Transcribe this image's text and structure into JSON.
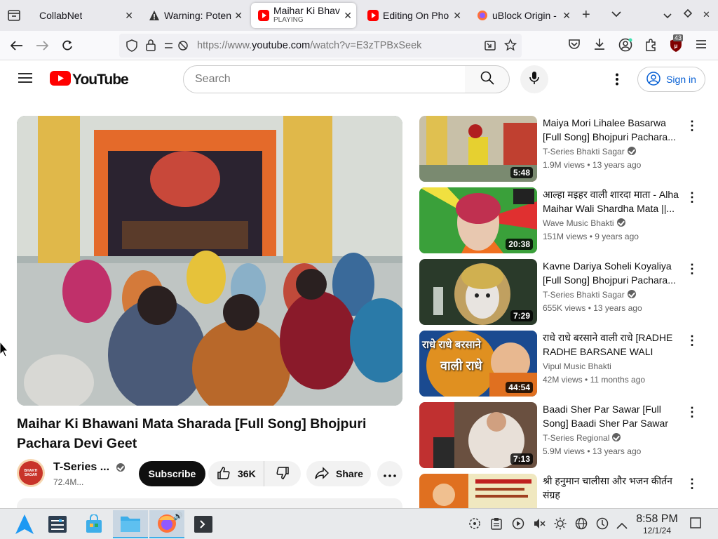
{
  "browser": {
    "tabs": [
      {
        "label": "CollabNet",
        "active": false
      },
      {
        "label": "Warning: Poten",
        "active": false
      },
      {
        "label": "Maihar Ki Bhav",
        "sublabel": "PLAYING",
        "active": true
      },
      {
        "label": "Editing On Pho",
        "active": false
      },
      {
        "label": "uBlock Origin -",
        "active": false
      }
    ],
    "url_prefix": "https://www.",
    "url_host": "youtube.com",
    "url_path": "/watch?v=E3zTPBxSeek",
    "ublock_count": "43"
  },
  "youtube": {
    "logo_text": "YouTube",
    "search_placeholder": "Search",
    "sign_in": "Sign in"
  },
  "video": {
    "title": "Maihar Ki Bhawani Mata Sharada [Full Song] Bhojpuri Pachara Devi Geet",
    "channel": "T-Series ...",
    "subscribers": "72.4M...",
    "subscribe_label": "Subscribe",
    "likes": "36K",
    "share_label": "Share",
    "avatar_text": "BHAKTI SAGAR"
  },
  "recommendations": [
    {
      "title": "Maiya Mori Lihalee Basarwa [Full Song] Bhojpuri Pachara...",
      "channel": "T-Series Bhakti Sagar",
      "verified": true,
      "views": "1.9M views",
      "age": "13 years ago",
      "duration": "5:48"
    },
    {
      "title": "आल्हा मइहर वाली शारदा माता - Alha Maihar Wali Shardha Mata ||...",
      "channel": "Wave Music Bhakti",
      "verified": true,
      "views": "151M views",
      "age": "9 years ago",
      "duration": "20:38"
    },
    {
      "title": "Kavne Dariya Soheli Koyaliya [Full Song] Bhojpuri Pachara...",
      "channel": "T-Series Bhakti Sagar",
      "verified": true,
      "views": "655K views",
      "age": "13 years ago",
      "duration": "7:29"
    },
    {
      "title": "राधे राधे बरसाने वाली राधे [RADHE RADHE BARSANE WALI RADH...",
      "channel": "Vipul Music Bhakti",
      "verified": false,
      "views": "42M views",
      "age": "11 months ago",
      "duration": "44:54",
      "thumb_text1": "राधे राधे बरसाने",
      "thumb_text2": "वाली राधे"
    },
    {
      "title": "Baadi Sher Par Sawar [Full Song] Baadi Sher Par Sawar",
      "channel": "T-Series Regional",
      "verified": true,
      "views": "5.9M views",
      "age": "13 years ago",
      "duration": "7:13"
    },
    {
      "title": "श्री हनुमान चालीसा और भजन कीर्तन संग्रह",
      "channel": "",
      "verified": false,
      "views": "",
      "age": "",
      "duration": ""
    }
  ],
  "taskbar": {
    "time": "8:58 PM",
    "date": "12/1/24"
  }
}
